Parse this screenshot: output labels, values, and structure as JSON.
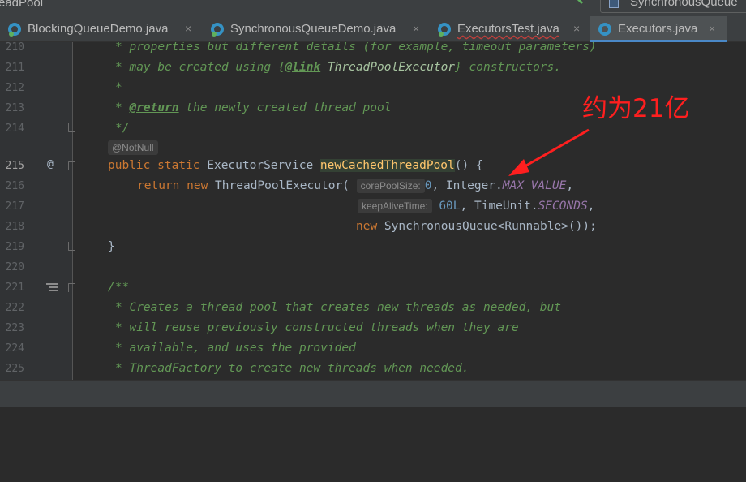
{
  "window": {
    "project_title": "eadPool",
    "run_config": "SynchronousQueue"
  },
  "tabs": [
    {
      "label": "BlockingQueueDemo.java",
      "close": "×"
    },
    {
      "label": "SynchronousQueueDemo.java",
      "close": "×"
    },
    {
      "label": "ExecutorsTest.java",
      "close": "×"
    },
    {
      "label": "Executors.java",
      "close": "×"
    }
  ],
  "gutter": {
    "lines": [
      "210",
      "211",
      "212",
      "213",
      "214",
      "215",
      "216",
      "217",
      "218",
      "219",
      "220",
      "221",
      "222",
      "223",
      "224",
      "225"
    ],
    "current_line": "215",
    "override_marker": "@"
  },
  "code": {
    "l210": "* properties but different details (for example, timeout parameters)",
    "l211_a": "* may be created using {",
    "l211_b": "@link",
    "l211_c": " ThreadPoolExecutor",
    "l211_d": "} constructors.",
    "l212": "*",
    "l213_a": "* ",
    "l213_b": "@return",
    "l213_c": " the newly created thread pool",
    "l214": "*/",
    "annotation_hint": "@NotNull",
    "l215_kw": "public static",
    "l215_type": " ExecutorService ",
    "l215_fn": "newCachedThreadPool",
    "l215_end": "() {",
    "l216_kw1": "return",
    "l216_kw2": " new",
    "l216_cls": " ThreadPoolExecutor(",
    "hint_core": "corePoolSize:",
    "l216_num": "0",
    "l216_mid": ", Integer.",
    "l216_const": "MAX_VALUE",
    "l216_end": ",",
    "hint_keep": "keepAliveTime:",
    "l217_num": "60L",
    "l217_mid": ", TimeUnit.",
    "l217_const": "SECONDS",
    "l217_end": ",",
    "l218_kw": "new",
    "l218_rest": " SynchronousQueue<Runnable>());",
    "l219": "}",
    "l220": "",
    "l221": "/**",
    "l222": "* Creates a thread pool that creates new threads as needed, but",
    "l223": "* will reuse previously constructed threads when they are",
    "l224": "* available, and uses the provided",
    "l225": "* ThreadFactory to create new threads when needed."
  },
  "annotation": {
    "text": "约为21亿",
    "color": "#ff1f1f"
  },
  "colors": {
    "keyword": "#cc7832",
    "comment": "#629755",
    "method": "#ffc66d",
    "constant": "#9876aa",
    "number": "#6897bb",
    "active_tab_underline": "#4a88c7"
  }
}
